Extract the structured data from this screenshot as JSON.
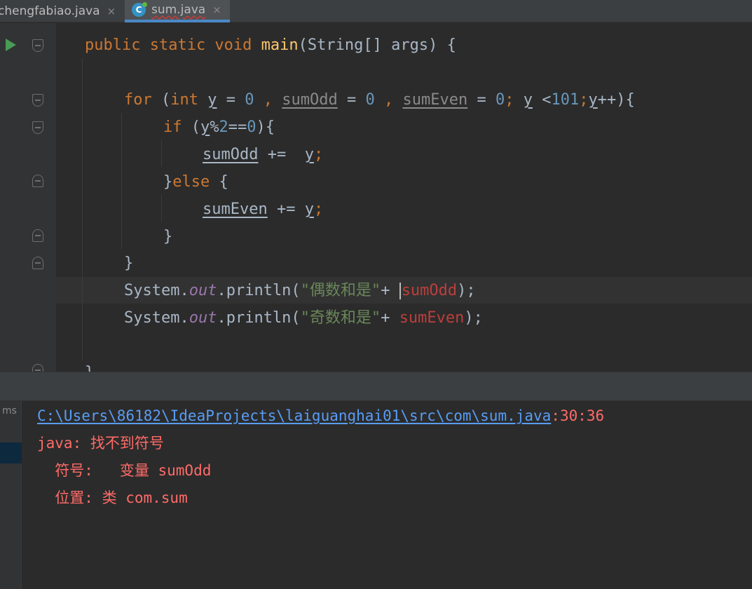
{
  "tabs": [
    {
      "label": "chengfabiao.java",
      "close": "×"
    },
    {
      "label": "sum.java",
      "close": "×",
      "icon": "C"
    }
  ],
  "code": {
    "l1": {
      "kw": "public static void",
      "fn": "main",
      "rest": "(String[] args) {"
    },
    "l3": {
      "for": "for",
      "p1": " (",
      "int": "int",
      "y1": "y",
      "eq1": " = ",
      "n0a": "0",
      "c1": " , ",
      "sumOdd": "sumOdd",
      "eq2": " = ",
      "n0b": "0",
      "c2": " , ",
      "sumEven": "sumEven",
      "eq3": " = ",
      "n0c": "0",
      "semi1": ";",
      "sp": " ",
      "y2": "y",
      "lt": " <",
      "n101": "101",
      "semi2": ";",
      "y3": "y",
      "inc": "++){"
    },
    "l4": {
      "if": "if",
      "p": " (",
      "y": "y",
      "pct": "%",
      "n2": "2",
      "eq": "==",
      "n0": "0",
      "close": "){"
    },
    "l5": {
      "var": "sumOdd",
      "op": " +=  ",
      "y": "y",
      "semi": ";"
    },
    "l6": {
      "brace": "}",
      "else": "else",
      "open": " {"
    },
    "l7": {
      "var": "sumEven",
      "op": " += ",
      "y": "y",
      "semi": ";"
    },
    "l8": {
      "brace": "}"
    },
    "l9": {
      "brace": "}"
    },
    "l10": {
      "sys": "System.",
      "out": "out",
      "pr": ".println(",
      "str": "\"偶数和是\"",
      "plus": "+ ",
      "var": "sumOdd",
      "end": ");"
    },
    "l11": {
      "sys": "System.",
      "out": "out",
      "pr": ".println(",
      "str": "\"奇数和是\"",
      "plus": "+ ",
      "var": "sumEven",
      "end": ");"
    },
    "l13": {
      "brace": "}"
    }
  },
  "output": {
    "side_label": "ms",
    "path": "C:\\Users\\86182\\IdeaProjects\\laiguanghai01\\src\\com\\sum.java",
    "loc": ":30:36",
    "err1": "java: 找不到符号",
    "err2": "  符号:   变量 sumOdd",
    "err3": "  位置: 类 com.sum"
  }
}
